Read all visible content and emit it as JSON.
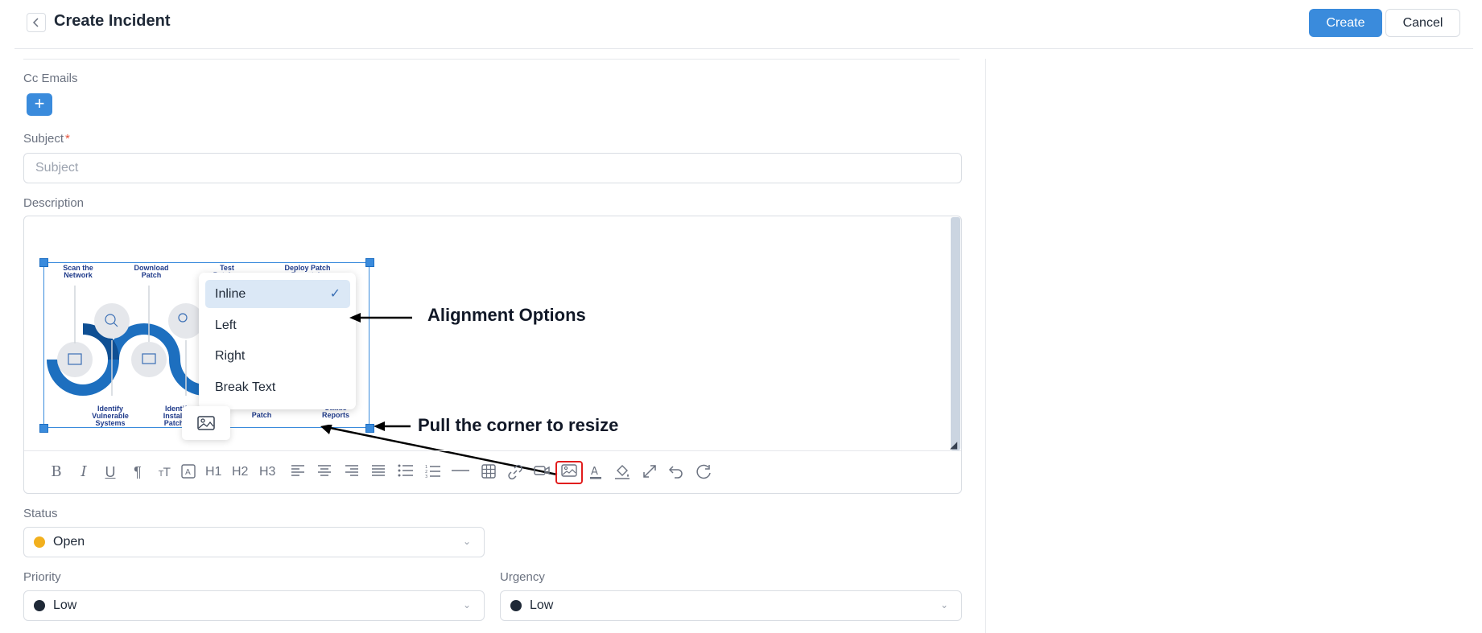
{
  "header": {
    "title": "Create Incident",
    "create_label": "Create",
    "cancel_label": "Cancel"
  },
  "form": {
    "cc_label": "Cc Emails",
    "cc_add_label": "+",
    "subject_label": "Subject",
    "subject_required": "*",
    "subject_placeholder": "Subject",
    "description_label": "Description",
    "status_label": "Status",
    "status_value": "Open",
    "status_color": "#f2b01e",
    "priority_label": "Priority",
    "priority_value": "Low",
    "priority_color": "#1f2937",
    "urgency_label": "Urgency",
    "urgency_value": "Low",
    "urgency_color": "#1f2937"
  },
  "image_alignment_menu": {
    "items": [
      {
        "label": "Inline",
        "selected": true
      },
      {
        "label": "Left",
        "selected": false
      },
      {
        "label": "Right",
        "selected": false
      },
      {
        "label": "Break Text",
        "selected": false
      }
    ],
    "check": "✓"
  },
  "diagram_captions": {
    "scan": "Scan the Network",
    "download": "Download Patch",
    "test": "Test Patches",
    "deploy": "Deploy Patch Remotely",
    "identify": "Identify Vulnerable Systems",
    "installed": "Identify Installed Patches",
    "patch": "Patch",
    "reports": "Status Reports"
  },
  "annotations": {
    "alignment": "Alignment Options",
    "resize": "Pull the corner to resize"
  },
  "toolbar": {
    "icons": [
      "bold-icon",
      "italic-icon",
      "underline-icon",
      "paragraph-icon",
      "font-size-icon",
      "text-box-icon",
      "h1",
      "h2",
      "h3",
      "align-left-icon",
      "align-center-icon",
      "align-right-icon",
      "align-justify-icon",
      "bulleted-list-icon",
      "numbered-list-icon",
      "horizontal-rule-icon",
      "table-icon",
      "link-icon",
      "video-icon",
      "image-icon",
      "text-color-icon",
      "fill-color-icon",
      "fullscreen-icon",
      "undo-icon",
      "redo-icon"
    ],
    "bold": "B",
    "italic": "I",
    "underline": "U",
    "paragraph": "¶",
    "h1": "H1",
    "h2": "H2",
    "h3": "H3"
  },
  "colors": {
    "accent": "#3a8bdc",
    "highlight": "#e11d1d"
  }
}
